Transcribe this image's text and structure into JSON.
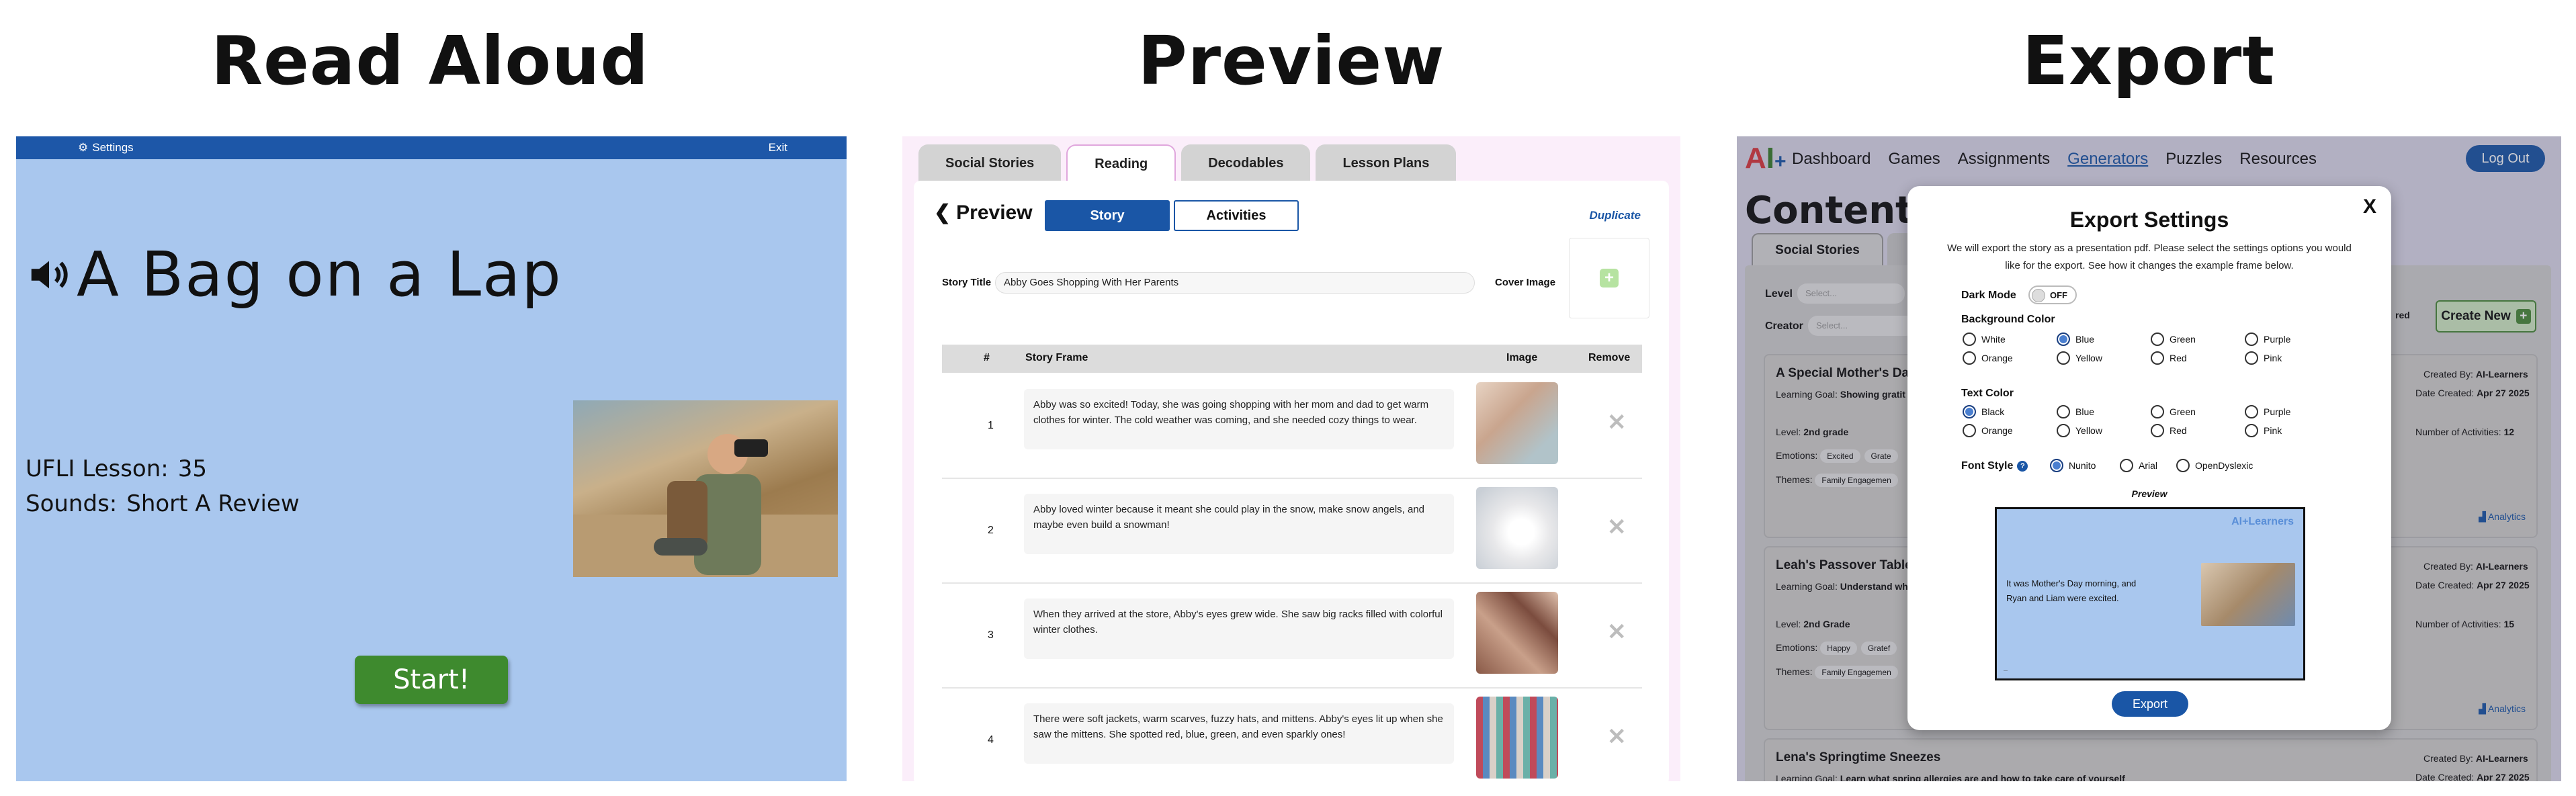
{
  "headings": {
    "read_aloud": "Read Aloud",
    "preview": "Preview",
    "export": "Export"
  },
  "read_aloud": {
    "settings_label": "Settings",
    "exit_label": "Exit",
    "story_title": "A Bag on a Lap",
    "lesson_label": "UFLI Lesson:",
    "lesson_value": "35",
    "sounds_label": "Sounds:",
    "sounds_value": "Short A Review",
    "start_label": "Start!",
    "colors": {
      "background": "#a9c7ee",
      "topbar": "#1d57a8",
      "start": "#3e8a2e"
    }
  },
  "preview": {
    "tabs": [
      "Social Stories",
      "Reading",
      "Decodables",
      "Lesson Plans"
    ],
    "active_tab": "Reading",
    "header": "Preview",
    "story_button": "Story",
    "activities_button": "Activities",
    "duplicate_label": "Duplicate",
    "story_title_label": "Story Title",
    "story_title_value": "Abby Goes Shopping With Her Parents",
    "cover_image_label": "Cover Image",
    "columns": [
      "#",
      "Story Frame",
      "Image",
      "Remove"
    ],
    "frames": [
      {
        "num": "1",
        "text": "Abby was so excited! Today, she was going shopping with her mom and dad to get warm clothes for winter. The cold weather was coming, and she needed cozy things to wear.",
        "image": "family-shopping-photo"
      },
      {
        "num": "2",
        "text": "Abby loved winter because it meant she could play in the snow, make snow angels, and maybe even build a snowman!",
        "image": "snowman-photo"
      },
      {
        "num": "3",
        "text": "When they arrived at the store, Abby's eyes grew wide. She saw big racks filled with colorful winter clothes.",
        "image": "clothes-rack-photo"
      },
      {
        "num": "4",
        "text": "There were soft jackets, warm scarves, fuzzy hats, and mittens. Abby's eyes lit up when she saw the mittens. She spotted red, blue, green, and even sparkly ones!",
        "image": "mittens-photo"
      }
    ]
  },
  "export": {
    "nav": [
      "Dashboard",
      "Games",
      "Assignments",
      "Generators",
      "Puzzles",
      "Resources"
    ],
    "active_nav": "Generators",
    "logout_label": "Log Out",
    "page_title": "Content Gen",
    "tab_social": "Social Stories",
    "level_label": "Level",
    "level_placeholder": "Select...",
    "creator_label": "Creator",
    "creator_placeholder": "Select...",
    "red_label": "red",
    "create_new_label": "Create New",
    "cards": [
      {
        "title": "A Special Mother's Day S",
        "goal_label": "Learning Goal:",
        "goal": "Showing gratit",
        "level_label": "Level:",
        "level": "2nd grade",
        "emotions_label": "Emotions:",
        "emotions": [
          "Excited",
          "Grate"
        ],
        "themes_label": "Themes:",
        "themes": [
          "Family Engagemen"
        ],
        "created_by_label": "Created By:",
        "created_by": "AI-Learners",
        "date_label": "Date Created:",
        "date": "Apr 27 2025",
        "activities_label": "Number of Activities:",
        "activities": "12",
        "analytics": "Analytics"
      },
      {
        "title": "Leah's Passover Table",
        "goal_label": "Learning Goal:",
        "goal": "Understand wha",
        "level_label": "Level:",
        "level": "2nd Grade",
        "emotions_label": "Emotions:",
        "emotions": [
          "Happy",
          "Gratef"
        ],
        "themes_label": "Themes:",
        "themes": [
          "Family Engagemen"
        ],
        "created_by_label": "Created By:",
        "created_by": "AI-Learners",
        "date_label": "Date Created:",
        "date": "Apr 27 2025",
        "activities_label": "Number of Activities:",
        "activities": "15",
        "analytics": "Analytics"
      },
      {
        "title": "Lena's Springtime Sneezes",
        "goal_label": "Learning Goal:",
        "goal": "Learn what spring allergies are and how to take care of yourself",
        "created_by_label": "Created By:",
        "created_by": "AI-Learners",
        "date_label": "Date Created:",
        "date": "Apr 27 2025"
      }
    ],
    "modal": {
      "title": "Export Settings",
      "close": "X",
      "description": "We will export the story as a presentation pdf. Please select the settings options you would like for the export. See how it changes the example frame below.",
      "dark_mode_label": "Dark Mode",
      "dark_mode_value": "OFF",
      "background_label": "Background Color",
      "background_options": [
        "White",
        "Blue",
        "Green",
        "Purple",
        "Orange",
        "Yellow",
        "Red",
        "Pink"
      ],
      "background_selected": "Blue",
      "text_label": "Text Color",
      "text_options": [
        "Black",
        "Blue",
        "Green",
        "Purple",
        "Orange",
        "Yellow",
        "Red",
        "Pink"
      ],
      "text_selected": "Black",
      "font_label": "Font Style",
      "font_options": [
        "Nunito",
        "Arial",
        "OpenDyslexic"
      ],
      "font_selected": "Nunito",
      "preview_label": "Preview",
      "preview_brand": "AI+Learners",
      "preview_text": "It was Mother's Day morning, and Ryan and Liam were excited.",
      "export_label": "Export"
    }
  }
}
